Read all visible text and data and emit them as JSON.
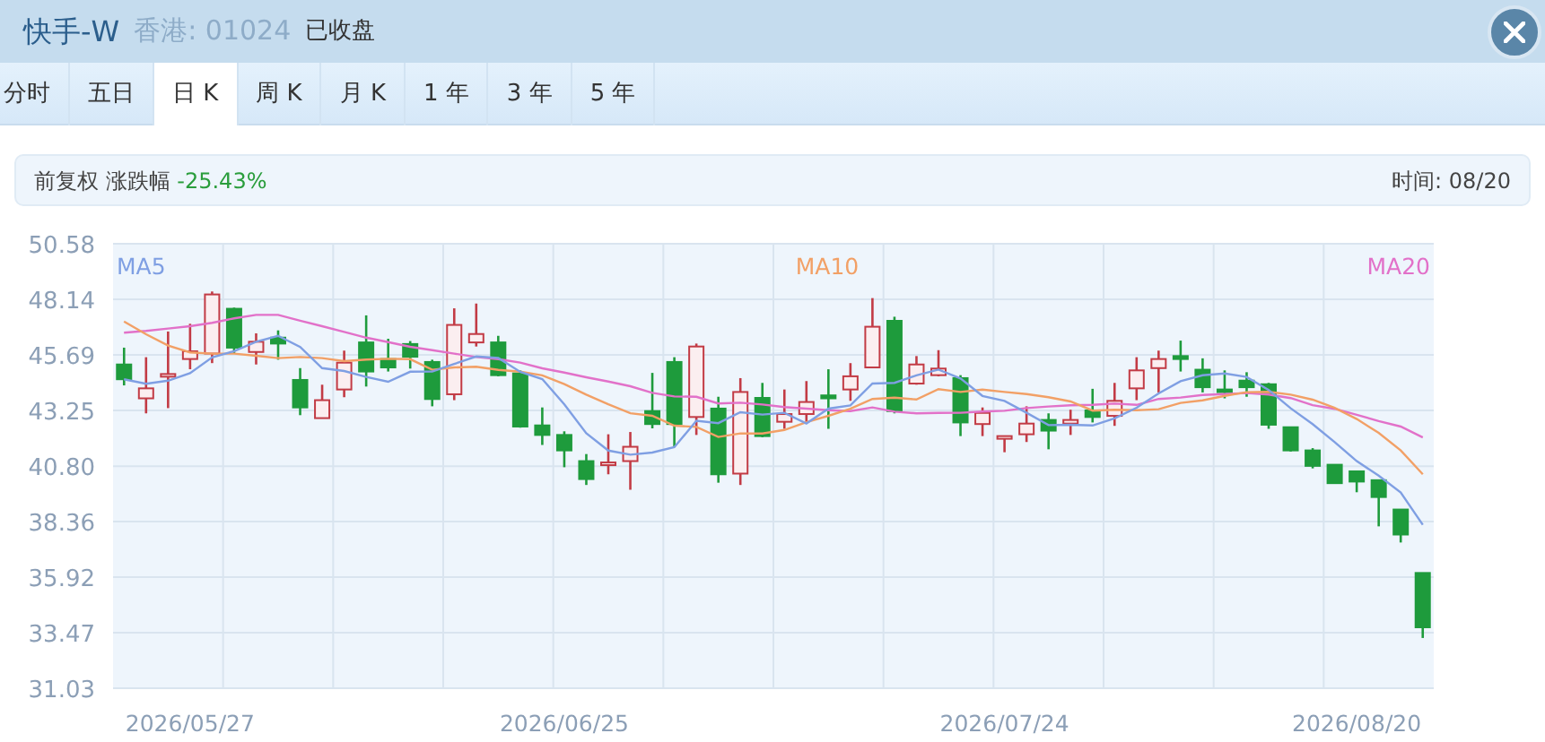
{
  "header": {
    "title": "快手-W",
    "market_code": "香港: 01024",
    "status": "已收盘"
  },
  "tabs": [
    {
      "label": "分时",
      "selected": false
    },
    {
      "label": "五日",
      "selected": false
    },
    {
      "label": "日 K",
      "selected": true
    },
    {
      "label": "周 K",
      "selected": false
    },
    {
      "label": "月 K",
      "selected": false
    },
    {
      "label": "1 年",
      "selected": false
    },
    {
      "label": "3 年",
      "selected": false
    },
    {
      "label": "5 年",
      "selected": false
    }
  ],
  "info_bar": {
    "adjustment": "前复权",
    "change_label": "涨跌幅",
    "change_value": "-25.43%",
    "time": "时间: 08/20"
  },
  "chart": {
    "chart_data": {
      "type": "candlestick",
      "grid": true,
      "ylim": [
        31.03,
        50.58
      ],
      "yticks": [
        {
          "value": 31.03,
          "label": "31.03"
        },
        {
          "value": 33.47,
          "label": "33.47"
        },
        {
          "value": 35.92,
          "label": "35.92"
        },
        {
          "value": 38.36,
          "label": "38.36"
        },
        {
          "value": 40.8,
          "label": "40.80"
        },
        {
          "value": 43.25,
          "label": "43.25"
        },
        {
          "value": 45.69,
          "label": "45.69"
        },
        {
          "value": 48.14,
          "label": "48.14"
        },
        {
          "value": 50.58,
          "label": "50.58"
        }
      ],
      "categories": [
        null,
        null,
        null,
        "2026/05/27",
        null,
        null,
        null,
        null,
        null,
        null,
        null,
        null,
        null,
        null,
        null,
        null,
        null,
        null,
        null,
        null,
        "2026/06/25",
        null,
        null,
        null,
        null,
        null,
        null,
        null,
        null,
        null,
        null,
        null,
        null,
        null,
        null,
        null,
        null,
        null,
        null,
        null,
        "2026/07/24",
        null,
        null,
        null,
        null,
        null,
        null,
        null,
        null,
        null,
        null,
        null,
        null,
        null,
        null,
        null,
        "2026/08/20",
        null,
        null,
        null
      ],
      "ohlc": [
        [
          45.27,
          46.01,
          44.35,
          44.62
        ],
        [
          43.78,
          45.59,
          43.12,
          44.22
        ],
        [
          44.8,
          46.72,
          43.35,
          44.85
        ],
        [
          45.51,
          47.06,
          45.06,
          45.85
        ],
        [
          45.75,
          48.48,
          45.33,
          48.35
        ],
        [
          47.72,
          47.77,
          45.75,
          46.01
        ],
        [
          45.82,
          46.64,
          45.27,
          46.27
        ],
        [
          46.45,
          46.77,
          45.48,
          46.19
        ],
        [
          44.59,
          45.11,
          43.04,
          43.38
        ],
        [
          42.91,
          44.38,
          42.91,
          43.7
        ],
        [
          44.17,
          45.88,
          43.83,
          45.35
        ],
        [
          46.24,
          47.43,
          44.3,
          44.96
        ],
        [
          45.51,
          46.4,
          44.96,
          45.14
        ],
        [
          46.17,
          46.3,
          45.09,
          45.61
        ],
        [
          45.38,
          45.48,
          43.43,
          43.75
        ],
        [
          43.96,
          47.74,
          43.7,
          47.01
        ],
        [
          46.24,
          47.95,
          46.06,
          46.61
        ],
        [
          46.24,
          46.53,
          44.75,
          44.8
        ],
        [
          44.88,
          45.01,
          42.49,
          42.54
        ],
        [
          42.59,
          43.38,
          41.73,
          42.17
        ],
        [
          42.17,
          42.33,
          40.75,
          41.49
        ],
        [
          41.02,
          41.33,
          39.97,
          40.23
        ],
        [
          40.91,
          42.2,
          40.44,
          40.96
        ],
        [
          41.02,
          42.3,
          39.76,
          41.65
        ],
        [
          43.22,
          44.9,
          42.46,
          42.65
        ],
        [
          45.38,
          45.59,
          41.67,
          42.65
        ],
        [
          42.96,
          46.19,
          42.17,
          46.06
        ],
        [
          43.33,
          43.85,
          40.07,
          40.44
        ],
        [
          40.47,
          44.67,
          39.97,
          44.06
        ],
        [
          43.8,
          44.46,
          42.07,
          42.12
        ],
        [
          42.75,
          44.17,
          42.44,
          43.09
        ],
        [
          43.09,
          44.54,
          42.72,
          43.62
        ],
        [
          43.91,
          45.06,
          42.44,
          43.78
        ],
        [
          44.17,
          45.33,
          43.67,
          44.75
        ],
        [
          45.14,
          48.19,
          45.14,
          46.93
        ],
        [
          47.19,
          47.37,
          43.12,
          43.22
        ],
        [
          44.43,
          45.64,
          44.38,
          45.27
        ],
        [
          44.8,
          45.9,
          44.75,
          45.09
        ],
        [
          44.67,
          44.8,
          42.12,
          42.72
        ],
        [
          42.65,
          43.38,
          42.12,
          43.14
        ],
        [
          42.07,
          42.12,
          41.41,
          42.12
        ],
        [
          42.2,
          43.43,
          41.86,
          42.67
        ],
        [
          42.83,
          43.12,
          41.54,
          42.36
        ],
        [
          42.67,
          43.28,
          42.17,
          42.83
        ],
        [
          43.25,
          44.2,
          42.72,
          42.96
        ],
        [
          43.01,
          44.46,
          42.57,
          43.67
        ],
        [
          44.22,
          45.59,
          43.7,
          45.01
        ],
        [
          45.11,
          45.88,
          44.04,
          45.51
        ],
        [
          45.64,
          46.32,
          44.96,
          45.51
        ],
        [
          45.04,
          45.54,
          44.04,
          44.27
        ],
        [
          44.17,
          45.01,
          43.78,
          44.06
        ],
        [
          44.56,
          44.93,
          43.85,
          44.27
        ],
        [
          44.4,
          44.46,
          42.44,
          42.62
        ],
        [
          42.51,
          42.51,
          41.44,
          41.49
        ],
        [
          41.49,
          41.59,
          40.7,
          40.81
        ],
        [
          40.86,
          40.86,
          40.02,
          40.05
        ],
        [
          40.57,
          40.57,
          39.65,
          40.12
        ],
        [
          40.18,
          40.18,
          38.15,
          39.44
        ],
        [
          38.89,
          38.89,
          37.44,
          37.79
        ],
        [
          36.1,
          36.1,
          33.24,
          33.71
        ]
      ],
      "series": [
        {
          "name": "MA5",
          "type": "line",
          "color": "#7f9fe3",
          "values": [
            44.62,
            44.42,
            44.56,
            44.89,
            45.58,
            45.86,
            46.27,
            46.53,
            46.04,
            45.11,
            44.98,
            44.72,
            44.51,
            44.95,
            44.96,
            45.29,
            45.62,
            45.56,
            44.94,
            44.63,
            43.52,
            42.25,
            41.48,
            41.3,
            41.4,
            41.63,
            42.79,
            42.69,
            43.17,
            43.07,
            43.15,
            42.67,
            43.33,
            43.47,
            44.43,
            44.46,
            44.79,
            45.05,
            44.65,
            43.89,
            43.67,
            43.15,
            42.6,
            42.62,
            42.59,
            42.9,
            43.37,
            44.0,
            44.53,
            44.79,
            44.87,
            44.72,
            44.15,
            43.34,
            42.65,
            41.85,
            41.02,
            40.38,
            39.64,
            38.22
          ]
        },
        {
          "name": "MA10",
          "type": "line",
          "color": "#f2a066",
          "values": [
            47.16,
            46.6,
            46.1,
            45.8,
            45.75,
            45.75,
            45.65,
            45.55,
            45.6,
            45.55,
            45.42,
            45.49,
            45.52,
            45.5,
            45.04,
            45.14,
            45.17,
            45.03,
            44.95,
            44.79,
            44.41,
            43.94,
            43.52,
            43.12,
            43.01,
            42.58,
            42.52,
            42.08,
            42.24,
            42.23,
            42.39,
            42.73,
            43.01,
            43.32,
            43.75,
            43.81,
            43.73,
            44.19,
            44.06,
            44.16,
            44.06,
            43.97,
            43.83,
            43.64,
            43.24,
            43.28,
            43.26,
            43.3,
            43.58,
            43.69,
            43.89,
            44.05,
            44.07,
            43.94,
            43.72,
            43.36,
            42.87,
            42.26,
            41.49,
            40.44
          ]
        },
        {
          "name": "MA20",
          "type": "line",
          "color": "#e271c9",
          "values": [
            46.67,
            46.75,
            46.85,
            46.95,
            47.1,
            47.3,
            47.45,
            47.45,
            47.2,
            46.95,
            46.7,
            46.45,
            46.25,
            46.05,
            45.9,
            45.75,
            45.6,
            45.5,
            45.35,
            45.1,
            44.91,
            44.71,
            44.52,
            44.31,
            44.02,
            43.86,
            43.85,
            43.56,
            43.59,
            43.51,
            43.4,
            43.33,
            43.26,
            43.22,
            43.38,
            43.19,
            43.12,
            43.14,
            43.15,
            43.2,
            43.23,
            43.35,
            43.42,
            43.48,
            43.49,
            43.55,
            43.49,
            43.75,
            43.82,
            43.93,
            43.97,
            44.01,
            43.95,
            43.79,
            43.48,
            43.32,
            43.06,
            42.78,
            42.54,
            42.06
          ]
        }
      ]
    }
  }
}
